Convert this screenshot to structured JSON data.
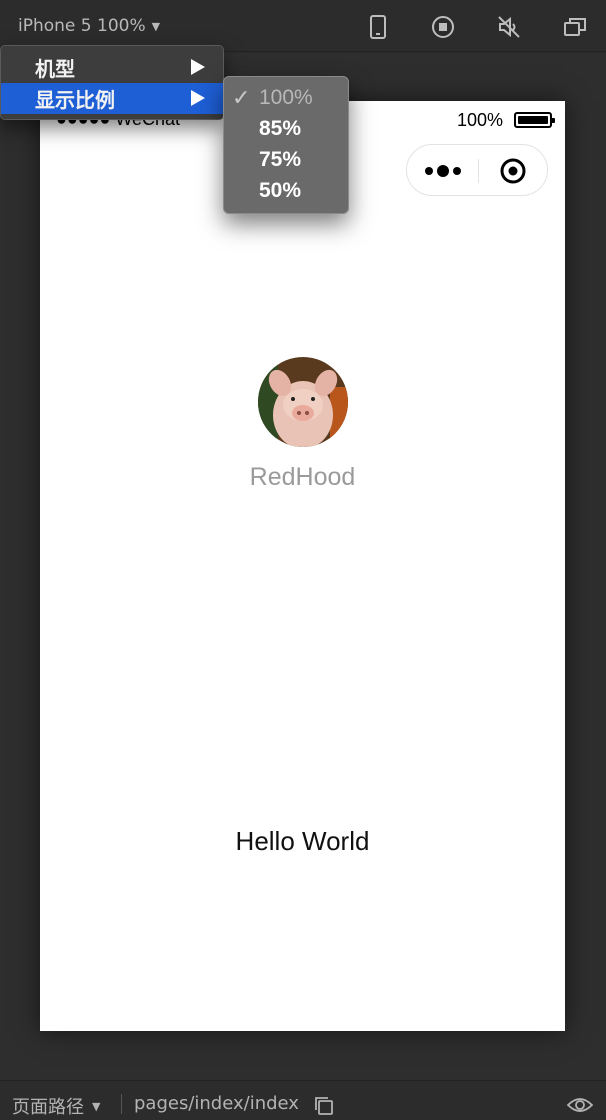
{
  "toolbar": {
    "device_label": "iPhone 5 100%",
    "icons": [
      "phone-icon",
      "record-icon",
      "mute-icon",
      "window-icon"
    ]
  },
  "status_bar": {
    "carrier": "●●●●● WeChat",
    "battery_text": "100%"
  },
  "page": {
    "nickname": "RedHood",
    "greeting": "Hello World"
  },
  "context_menu": {
    "items": [
      {
        "label": "机型"
      },
      {
        "label": "显示比例"
      }
    ],
    "zoom_options": [
      {
        "label": "100%",
        "checked": true
      },
      {
        "label": "85%",
        "checked": false
      },
      {
        "label": "75%",
        "checked": false
      },
      {
        "label": "50%",
        "checked": false
      }
    ],
    "check_mark": "✓"
  },
  "bottom_bar": {
    "label": "页面路径",
    "path": "pages/index/index"
  },
  "colors": {
    "menu_active": "#1e5fd6",
    "toolbar_bg": "#2c2c2c"
  }
}
